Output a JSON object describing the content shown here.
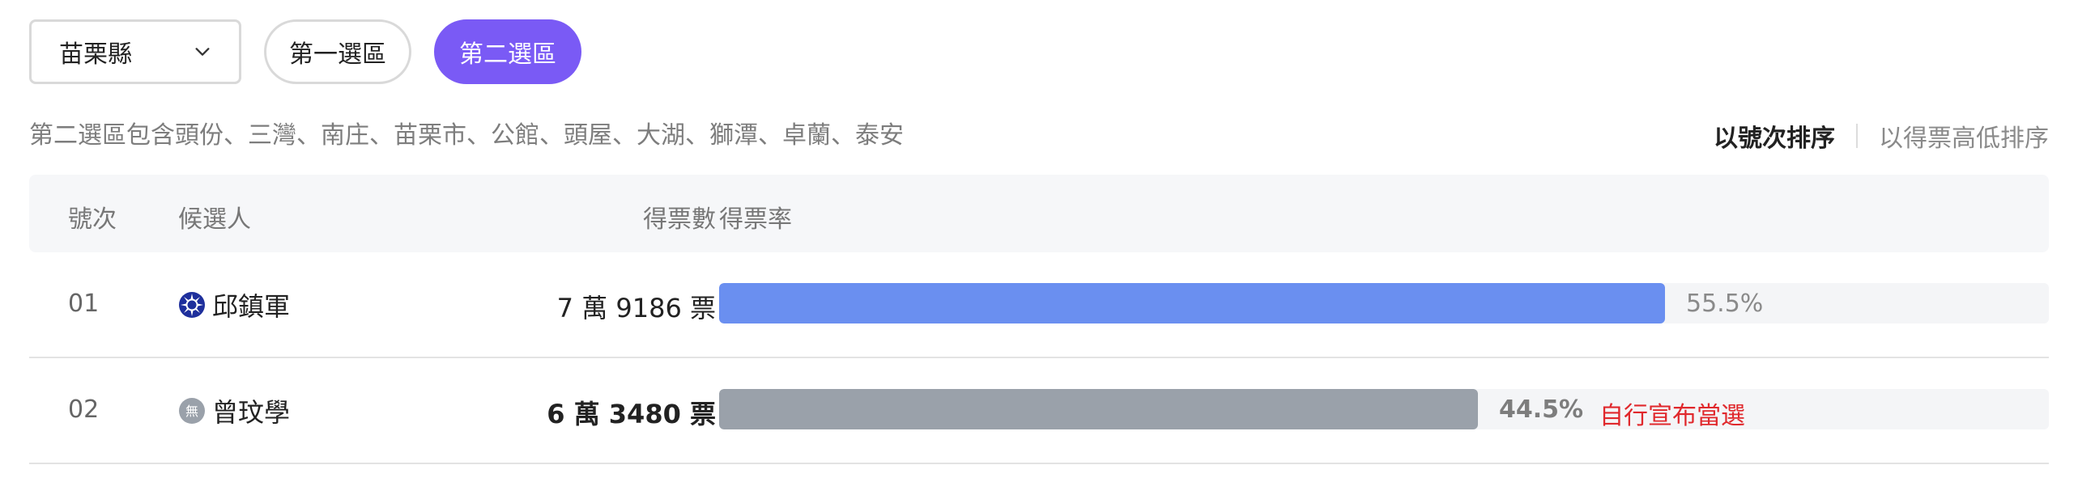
{
  "filters": {
    "county_select": "苗栗縣",
    "districts": [
      {
        "label": "第一選區",
        "active": false
      },
      {
        "label": "第二選區",
        "active": true
      }
    ]
  },
  "district_description": "第二選區包含頭份、三灣、南庄、苗栗市、公館、頭屋、大湖、獅潭、卓蘭、泰安",
  "sort": {
    "by_number": "以號次排序",
    "by_votes": "以得票高低排序",
    "selected": "by_number"
  },
  "table": {
    "headers": {
      "number": "號次",
      "candidate": "候選人",
      "votes": "得票數",
      "rate": "得票率"
    },
    "rows": [
      {
        "number": "01",
        "name": "邱鎮軍",
        "party_icon": "kmt-emblem-icon",
        "votes": "7 萬 9186 票",
        "votes_bold": false,
        "rate_value": 55.5,
        "rate_label": "55.5%",
        "bar_color": "#6a8ff0",
        "rate_color": "#8a8a8a",
        "note": ""
      },
      {
        "number": "02",
        "name": "曾玟學",
        "party_icon": "independent-icon",
        "votes": "6 萬 3480 票",
        "votes_bold": true,
        "rate_value": 44.5,
        "rate_label": "44.5%",
        "bar_color": "#9aa1aa",
        "rate_color": "#7d7d7d",
        "note": "自行宣布當選",
        "note_color": "#e0282c"
      }
    ]
  },
  "colors": {
    "accent": "#7a5af5"
  }
}
